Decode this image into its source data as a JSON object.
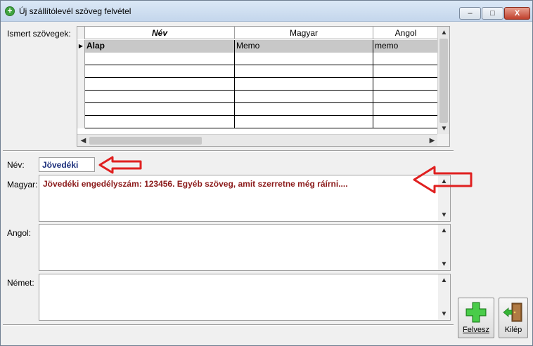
{
  "window": {
    "title": "Új szállítólevél szöveg felvétel",
    "controls": {
      "minimize": "–",
      "maximize": "□",
      "close": "X"
    }
  },
  "known_texts": {
    "label": "Ismert szövegek:",
    "columns": [
      "Név",
      "Magyar",
      "Angol"
    ],
    "rows": [
      {
        "nev": "Alap",
        "magyar": "Memo",
        "angol": "memo",
        "selected": true
      }
    ],
    "empty_rows": 6
  },
  "form": {
    "nev_label": "Név:",
    "nev_value": "Jövedéki",
    "magyar_label": "Magyar:",
    "magyar_value": "Jövedéki engedélyszám: 123456. Egyéb szöveg, amit szerretne még ráírni....",
    "angol_label": "Angol:",
    "angol_value": "",
    "nemet_label": "Német:",
    "nemet_value": ""
  },
  "buttons": {
    "felvesz": "Felvesz",
    "kilep": "Kilép"
  },
  "icons": {
    "title": "plus-circle-icon",
    "felvesz": "green-plus-icon",
    "kilep": "exit-door-icon",
    "annotation": "red-arrow-icon"
  },
  "colors": {
    "selection": "#c8c8c8",
    "nev_text": "#1a2d7a",
    "memo_text": "#8b1a1a",
    "arrow": "#e02020"
  }
}
